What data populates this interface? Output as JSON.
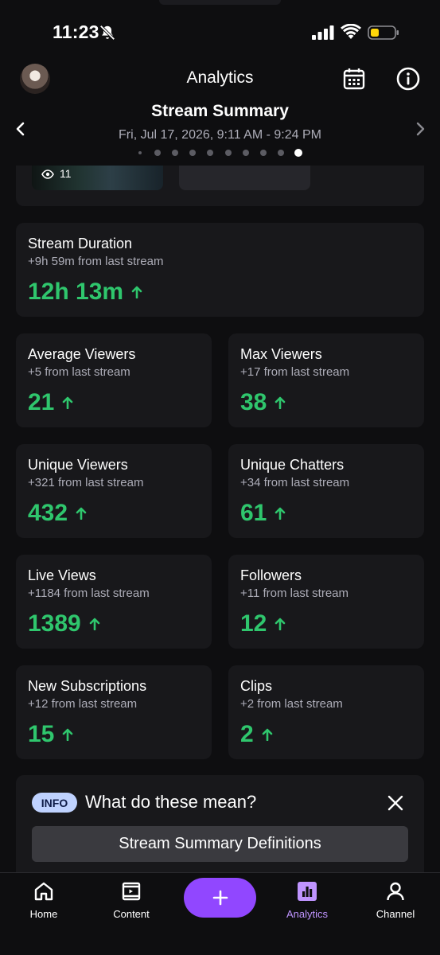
{
  "status_bar": {
    "time": "11:23"
  },
  "header": {
    "title": "Analytics"
  },
  "summary": {
    "title": "Stream Summary",
    "date": "Fri, Jul 17, 2026, 9:11 AM - 9:24 PM",
    "page_count": 10,
    "active_page": 10
  },
  "clip_preview": {
    "views": "11"
  },
  "stats": [
    {
      "label": "Stream Duration",
      "sub": "+9h 59m from last stream",
      "value": "12h 13m"
    },
    {
      "label": "Average Viewers",
      "sub": "+5 from last stream",
      "value": "21"
    },
    {
      "label": "Max Viewers",
      "sub": "+17 from last stream",
      "value": "38"
    },
    {
      "label": "Unique Viewers",
      "sub": "+321 from last stream",
      "value": "432"
    },
    {
      "label": "Unique Chatters",
      "sub": "+34 from last stream",
      "value": "61"
    },
    {
      "label": "Live Views",
      "sub": "+1184 from last stream",
      "value": "1389"
    },
    {
      "label": "Followers",
      "sub": "+11 from last stream",
      "value": "12"
    },
    {
      "label": "New Subscriptions",
      "sub": "+12 from last stream",
      "value": "15"
    },
    {
      "label": "Clips",
      "sub": "+2 from last stream",
      "value": "2"
    }
  ],
  "info": {
    "badge": "INFO",
    "question": "What do these mean?",
    "button": "Stream Summary Definitions"
  },
  "tabs": [
    {
      "label": "Home"
    },
    {
      "label": "Content"
    },
    {
      "label": "Analytics"
    },
    {
      "label": "Channel"
    }
  ],
  "colors": {
    "background": "#0e0e10",
    "card": "#18181b",
    "positive": "#2fc66d",
    "accent": "#9147ff",
    "accent_light": "#bf94ff",
    "info_badge": "#bfd2ff"
  },
  "icons": {
    "bell": "bell-off-icon",
    "calendar": "calendar-icon",
    "info": "info-circle-icon",
    "prev": "chevron-left-icon",
    "next": "chevron-right-icon",
    "eye": "eye-icon",
    "up": "arrow-up-icon",
    "close": "close-icon",
    "home": "home-icon",
    "content": "film-icon",
    "analytics": "bar-chart-icon",
    "channel": "person-icon",
    "plus": "plus-icon"
  }
}
